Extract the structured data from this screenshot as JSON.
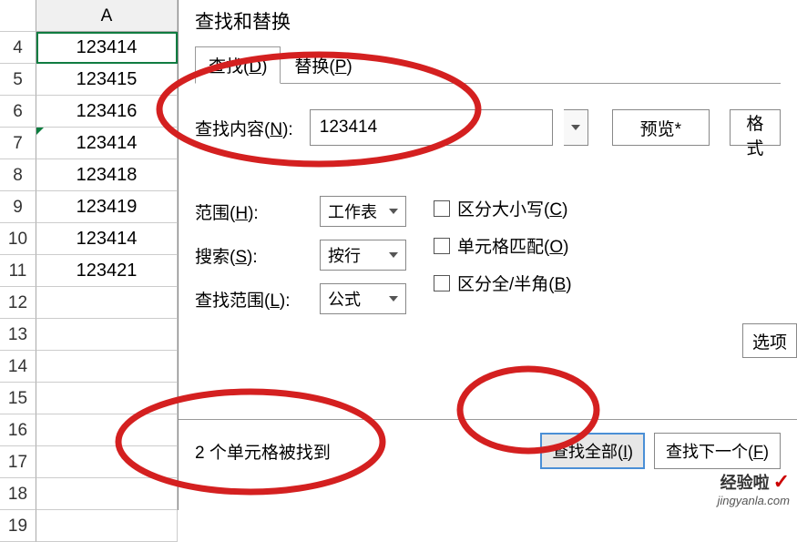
{
  "spreadsheet": {
    "col_header": "A",
    "rows": [
      {
        "n": 4,
        "v": "123414",
        "sel": true
      },
      {
        "n": 5,
        "v": "123415"
      },
      {
        "n": 6,
        "v": "123416"
      },
      {
        "n": 7,
        "v": "123414",
        "tri": true
      },
      {
        "n": 8,
        "v": "123418"
      },
      {
        "n": 9,
        "v": "123419"
      },
      {
        "n": 10,
        "v": "123414"
      },
      {
        "n": 11,
        "v": "123421"
      },
      {
        "n": 12,
        "v": ""
      },
      {
        "n": 13,
        "v": ""
      },
      {
        "n": 14,
        "v": ""
      },
      {
        "n": 15,
        "v": ""
      },
      {
        "n": 16,
        "v": ""
      },
      {
        "n": 17,
        "v": ""
      },
      {
        "n": 18,
        "v": ""
      },
      {
        "n": 19,
        "v": ""
      }
    ]
  },
  "dialog": {
    "title": "查找和替换",
    "tabs": {
      "find": "查找(D)",
      "replace": "替换(P)"
    },
    "find_label": "查找内容(N):",
    "find_value": "123414",
    "preview_btn": "预览*",
    "format_btn": "格式",
    "scope_label": "范围(H):",
    "scope_value": "工作表",
    "search_label": "搜索(S):",
    "search_value": "按行",
    "lookin_label": "查找范围(L):",
    "lookin_value": "公式",
    "match_case": "区分大小写(C)",
    "match_cell": "单元格匹配(O)",
    "match_width": "区分全/半角(B)",
    "options_btn": "选项",
    "status": "2 个单元格被找到",
    "find_all_btn": "查找全部(I)",
    "find_next_btn": "查找下一个(F)"
  },
  "watermark": {
    "brand": "经验啦",
    "url": "jingyanla.com"
  }
}
